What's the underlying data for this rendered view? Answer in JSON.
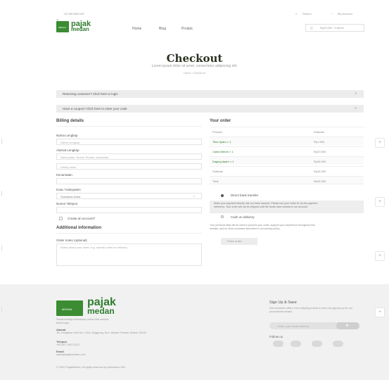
{
  "topbar": {
    "phone": "+62 8824567467",
    "search": "Search",
    "account": "My Account"
  },
  "brand": {
    "name_line1": "pajak",
    "name_line2": "medan",
    "mini_tag": "MEDAN"
  },
  "nav": {
    "items": [
      "Home",
      "Blog",
      "Produk"
    ],
    "cart": "Rp34.000 / 3 items"
  },
  "hero": {
    "title": "Checkout",
    "subtitle": "Lorem ipsum dolor sit amet, consectetur adipiscing elit.",
    "breadcrumb": "Home / Checkout"
  },
  "notices": {
    "returning": "Returning customer? Click here to login",
    "coupon": "Have a coupon? Click here to enter your code",
    "toggle": "»"
  },
  "billing": {
    "heading": "Billing details",
    "name_label": "Nama Lengkap",
    "name_placeholder": "Nama Lengkap",
    "address_label": "Alamat Lengkap",
    "address_placeholder": "Nama jalan, Nomor Rumah, kelurahan",
    "address2_placeholder": "Detail posisi",
    "district_label": "Kecamatan",
    "city_label": "Kota / Kabupaten",
    "city_value": "Sumatera Utara",
    "city_caret": "⌄",
    "phone_label": "Nomor Telepon",
    "create_account": "Create an account?"
  },
  "additional": {
    "heading": "Additional information",
    "notes_label": "Order notes (optional)",
    "notes_placeholder": "Notes about your order, e.g. special notes for delivery."
  },
  "order": {
    "heading": "Your order",
    "col_product": "Product",
    "col_subtotal": "Subtotal",
    "rows": [
      {
        "product": "Telur Ayam",
        "qty": "× 1",
        "subtotal": "Rp1.500"
      },
      {
        "product": "Cabai Merah",
        "qty": "× 1",
        "subtotal": "Rp20.000"
      },
      {
        "product": "Daging Ayam",
        "qty": "× 1",
        "subtotal": "Rp36.000"
      }
    ],
    "subtotal_label": "Subtotal",
    "subtotal_value": "Rp34.000",
    "total_label": "Total",
    "total_value": "Rp34.000"
  },
  "payment": {
    "bank": "Direct bank transfer",
    "bank_desc": "Make your payment directly into our bank account. Please use your Order ID as the payment reference. Your order will not be shipped until the funds have cleared in our account.",
    "cod": "Cash on delivery",
    "privacy": "Your personal data will be used to process your order, support your experience throughout this website, and for other purposes described in our privacy policy.",
    "place_order": "Place order"
  },
  "footer": {
    "tagline": "Solusi belanja kebutuhan pokok dari sumber terpercaya",
    "alamat_label": "Alamat",
    "alamat_value": "Jln. Pangeran Intel No. 4 Kel. Anggrung, Kec. Medan Polonia, Medan 20152",
    "telepon_label": "Telepon",
    "telepon_value": "+62 857 1441 2222",
    "email_label": "Email",
    "email_value": "sales@pajakmedan.com",
    "copyright": "© 2022 PajakMedan. All rights reserved by Almiracine 360",
    "signup_title": "Sign Up & Save",
    "signup_desc": "Get exclusive offers, free shipping events & more by signing up for our promotional emails.",
    "email_placeholder": "Enter your email address",
    "follow": "Follow us"
  },
  "side": {
    "plus": "+"
  },
  "colors": {
    "brand": "#2f7d2f",
    "title": "#2a3320",
    "accent_bar": "#ececec",
    "footer_bg": "#f1f1f1"
  }
}
